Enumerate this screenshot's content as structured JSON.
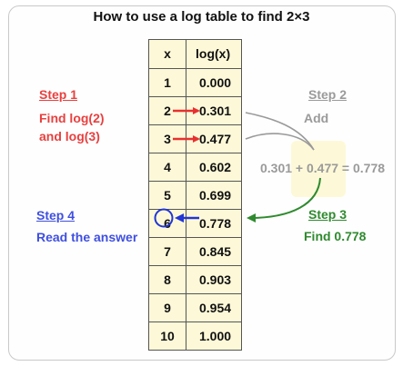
{
  "title": "How to use a log table to find 2×3",
  "table": {
    "headers": [
      "x",
      "log(x)"
    ],
    "rows": [
      {
        "x": "1",
        "log": "0.000"
      },
      {
        "x": "2",
        "log": "0.301"
      },
      {
        "x": "3",
        "log": "0.477"
      },
      {
        "x": "4",
        "log": "0.602"
      },
      {
        "x": "5",
        "log": "0.699"
      },
      {
        "x": "6",
        "log": "0.778"
      },
      {
        "x": "7",
        "log": "0.845"
      },
      {
        "x": "8",
        "log": "0.903"
      },
      {
        "x": "9",
        "log": "0.954"
      },
      {
        "x": "10",
        "log": "1.000"
      }
    ]
  },
  "steps": {
    "step1": {
      "heading": "Step 1",
      "line1": "Find log(2)",
      "line2": "and log(3)",
      "color": "#e8403f"
    },
    "step2": {
      "heading": "Step 2",
      "line1": "Add",
      "color": "#9a9a9a"
    },
    "step3": {
      "heading": "Step 3",
      "line1": "Find 0.778",
      "color": "#2f8a2f"
    },
    "step4": {
      "heading": "Step 4",
      "line1": "Read the answer",
      "color": "#3f4fe0"
    }
  },
  "equation": "0.301 + 0.477 = 0.778"
}
